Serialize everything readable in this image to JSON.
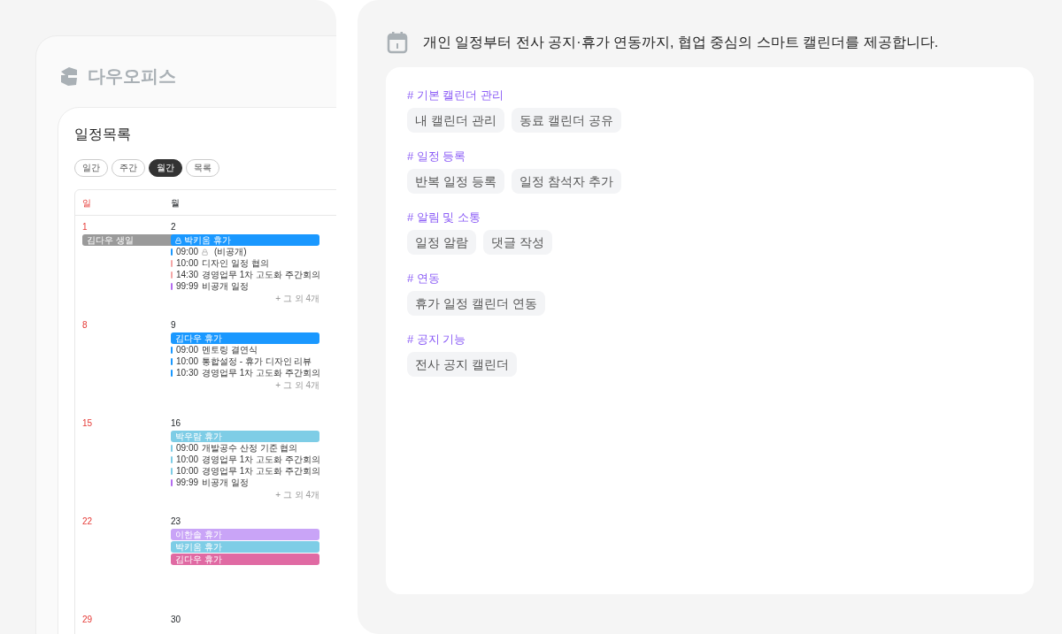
{
  "app": {
    "logo_text": "다우오피스"
  },
  "schedule": {
    "title": "일정목록",
    "views": [
      {
        "label": "일간",
        "selected": false
      },
      {
        "label": "주간",
        "selected": false
      },
      {
        "label": "월간",
        "selected": true
      },
      {
        "label": "목록",
        "selected": false
      }
    ],
    "columns": [
      {
        "label": "일",
        "kind": "sunday"
      },
      {
        "label": "월",
        "kind": "weekday"
      }
    ],
    "weeks": [
      {
        "cells": [
          {
            "date": "1",
            "kind": "sunday",
            "events": [
              {
                "kind": "bar",
                "title": "김다우 생일",
                "color": "#9a9a9a"
              }
            ]
          },
          {
            "date": "2",
            "kind": "weekday",
            "events": [
              {
                "kind": "bar",
                "title": "박키움 휴가",
                "color": "#1a98ff",
                "lock": true
              },
              {
                "kind": "item",
                "time": "09:00",
                "title": "(비공개)",
                "color": "#1a98ff",
                "lock": true
              },
              {
                "kind": "item",
                "time": "10:00",
                "title": "디자인 일정 협의",
                "color": "#f4a7a7"
              },
              {
                "kind": "item",
                "time": "14:30",
                "title": "경영업무 1차 고도화 주간회의",
                "color": "#f4a7a7"
              },
              {
                "kind": "item",
                "time": "99:99",
                "title": "비공개 일정",
                "color": "#b46cf0"
              }
            ],
            "more": "+ 그 외 4개"
          }
        ]
      },
      {
        "cells": [
          {
            "date": "8",
            "kind": "sunday"
          },
          {
            "date": "9",
            "kind": "weekday",
            "events": [
              {
                "kind": "bar",
                "title": "김다우 휴가",
                "color": "#1a98ff"
              },
              {
                "kind": "item",
                "time": "09:00",
                "title": "멘토링 결연식",
                "color": "#1a98ff"
              },
              {
                "kind": "item",
                "time": "10:00",
                "title": "통합설정 - 휴가 디자인 리뷰",
                "color": "#1a98ff"
              },
              {
                "kind": "item",
                "time": "10:30",
                "title": "경영업무 1차 고도화 주간회의",
                "color": "#1a98ff"
              }
            ],
            "more": "+ 그 외 4개"
          }
        ]
      },
      {
        "cells": [
          {
            "date": "15",
            "kind": "sunday"
          },
          {
            "date": "16",
            "kind": "weekday",
            "events": [
              {
                "kind": "bar",
                "title": "박우람 휴가",
                "color": "#7ecde6"
              },
              {
                "kind": "item",
                "time": "09:00",
                "title": "개발공수 산정 기준 협의",
                "color": "#7ecde6"
              },
              {
                "kind": "item",
                "time": "10:00",
                "title": "경영업무 1차 고도화 주간회의",
                "color": "#7ecde6"
              },
              {
                "kind": "item",
                "time": "10:00",
                "title": "경영업무 1차 고도화 주간회의",
                "color": "#7ecde6"
              },
              {
                "kind": "item",
                "time": "99:99",
                "title": "비공개 일정",
                "color": "#b46cf0"
              }
            ],
            "more": "+ 그 외 4개"
          }
        ]
      },
      {
        "cells": [
          {
            "date": "22",
            "kind": "sunday"
          },
          {
            "date": "23",
            "kind": "weekday",
            "events": [
              {
                "kind": "bar",
                "title": "이한솔 휴가",
                "color": "#c9a4f7"
              },
              {
                "kind": "bar",
                "title": "박키움 휴가",
                "color": "#7ecde6"
              },
              {
                "kind": "bar",
                "title": "김다우 휴가",
                "color": "#e06aa3"
              }
            ]
          }
        ]
      },
      {
        "cells": [
          {
            "date": "29",
            "kind": "sunday"
          },
          {
            "date": "30",
            "kind": "weekday"
          }
        ]
      }
    ]
  },
  "feature": {
    "headline": "개인 일정부터 전사 공지·휴가 연동까지, 협업 중심의 스마트 캘린더를 제공합니다.",
    "sections": [
      {
        "heading": "# 기본 캘린더 관리",
        "tags": [
          "내 캘린더 관리",
          "동료 캘린더 공유"
        ]
      },
      {
        "heading": "# 일정 등록",
        "tags": [
          "반복 일정 등록",
          "일정 참석자 추가"
        ]
      },
      {
        "heading": "# 알림 및 소통",
        "tags": [
          "일정 알람",
          "댓글 작성"
        ]
      },
      {
        "heading": "# 연동",
        "tags": [
          "휴가 일정 캘린더 연동"
        ]
      },
      {
        "heading": "# 공지 기능",
        "tags": [
          "전사 공지 캘린더"
        ]
      }
    ]
  }
}
